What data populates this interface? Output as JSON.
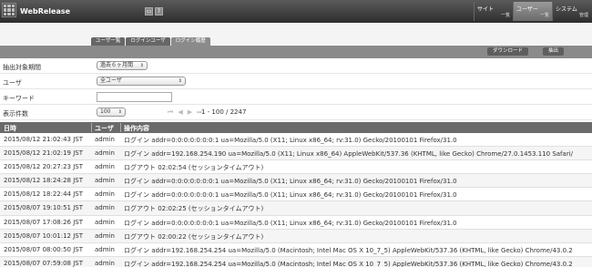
{
  "app": {
    "title": "WebRelease"
  },
  "toolbar": {
    "icon1": "▭",
    "icon2": "?"
  },
  "nav": [
    {
      "label": "サイト",
      "sub": "一覧"
    },
    {
      "label": "ユーザー",
      "sub": "一覧"
    },
    {
      "label": "システム",
      "sub": "管理"
    }
  ],
  "subtabs": [
    "ユーザ一覧",
    "ログインユーザ",
    "ログイン履歴"
  ],
  "actions": {
    "download": "ダウンロード",
    "extract": "抽出"
  },
  "form": {
    "period_label": "抽出対象期間",
    "period_value": "過去６ヶ月間",
    "user_label": "ユーザ",
    "user_value": "全ユーザ",
    "keyword_label": "キーワード",
    "keyword_value": "",
    "count_label": "表示件数",
    "count_value": "100",
    "pager_text": "1 - 100  /  2247"
  },
  "table": {
    "headers": {
      "date": "日時",
      "user": "ユーザ",
      "op": "操作内容"
    },
    "rows": [
      {
        "date": "2015/08/12 21:02:43 JST",
        "user": "admin",
        "op": "ログイン addr=0:0:0:0:0:0:0:1 ua=Mozilla/5.0 (X11; Linux x86_64; rv:31.0) Gecko/20100101 Firefox/31.0"
      },
      {
        "date": "2015/08/12 21:02:19 JST",
        "user": "admin",
        "op": "ログイン addr=192.168.254.190 ua=Mozilla/5.0 (X11; Linux x86_64) AppleWebKit/537.36 (KHTML, like Gecko) Chrome/27.0.1453.110 Safari/"
      },
      {
        "date": "2015/08/12 20:27:23 JST",
        "user": "admin",
        "op": "ログアウト 02:02:54 (セッションタイムアウト)"
      },
      {
        "date": "2015/08/12 18:24:28 JST",
        "user": "admin",
        "op": "ログイン addr=0:0:0:0:0:0:0:1 ua=Mozilla/5.0 (X11; Linux x86_64; rv:31.0) Gecko/20100101 Firefox/31.0"
      },
      {
        "date": "2015/08/12 18:22:44 JST",
        "user": "admin",
        "op": "ログイン addr=0:0:0:0:0:0:0:1 ua=Mozilla/5.0 (X11; Linux x86_64; rv:31.0) Gecko/20100101 Firefox/31.0"
      },
      {
        "date": "2015/08/07 19:10:51 JST",
        "user": "admin",
        "op": "ログアウト 02:02:25 (セッションタイムアウト)"
      },
      {
        "date": "2015/08/07 17:08:26 JST",
        "user": "admin",
        "op": "ログイン addr=0:0:0:0:0:0:0:1 ua=Mozilla/5.0 (X11; Linux x86_64; rv:31.0) Gecko/20100101 Firefox/31.0"
      },
      {
        "date": "2015/08/07 10:01:12 JST",
        "user": "admin",
        "op": "ログアウト 02:00:22 (セッションタイムアウト)"
      },
      {
        "date": "2015/08/07 08:00:50 JST",
        "user": "admin",
        "op": "ログイン addr=192.168.254.254 ua=Mozilla/5.0 (Macintosh; Intel Mac OS X 10_7_5) AppleWebKit/537.36 (KHTML, like Gecko) Chrome/43.0.2"
      },
      {
        "date": "2015/08/07 07:59:08 JST",
        "user": "admin",
        "op": "ログイン addr=192.168.254.254 ua=Mozilla/5.0 (Macintosh; Intel Mac OS X 10_7_5) AppleWebKit/537.36 (KHTML, like Gecko) Chrome/43.0.2"
      }
    ]
  }
}
